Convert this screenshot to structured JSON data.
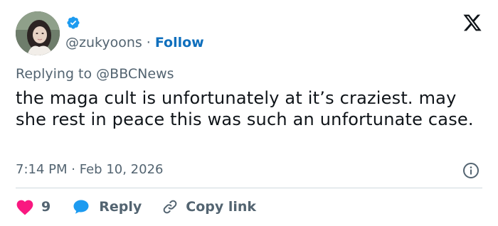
{
  "user": {
    "handle": "@zukyoons",
    "separator": "·",
    "follow_label": "Follow",
    "verified_icon": "verified-badge-icon",
    "avatar": "user-avatar-photo"
  },
  "brand_icon": "x-logo-icon",
  "reply_context": {
    "prefix": "Replying to",
    "mention": "@BBCNews"
  },
  "tweet": {
    "text": "the maga cult is unfortunately at it’s craziest. may she rest in peace this was such an unfortunate case.",
    "time": "7:14 PM",
    "separator": "·",
    "date": "Feb 10, 2026"
  },
  "actions": {
    "like_count": "9",
    "reply_label": "Reply",
    "copy_label": "Copy link"
  },
  "colors": {
    "accent_blue": "#1d9bf0",
    "follow_blue": "#0f6fbd",
    "like_pink": "#f91880",
    "muted_text": "#536471",
    "primary_text": "#0f1419",
    "divider": "#cfd9de"
  }
}
